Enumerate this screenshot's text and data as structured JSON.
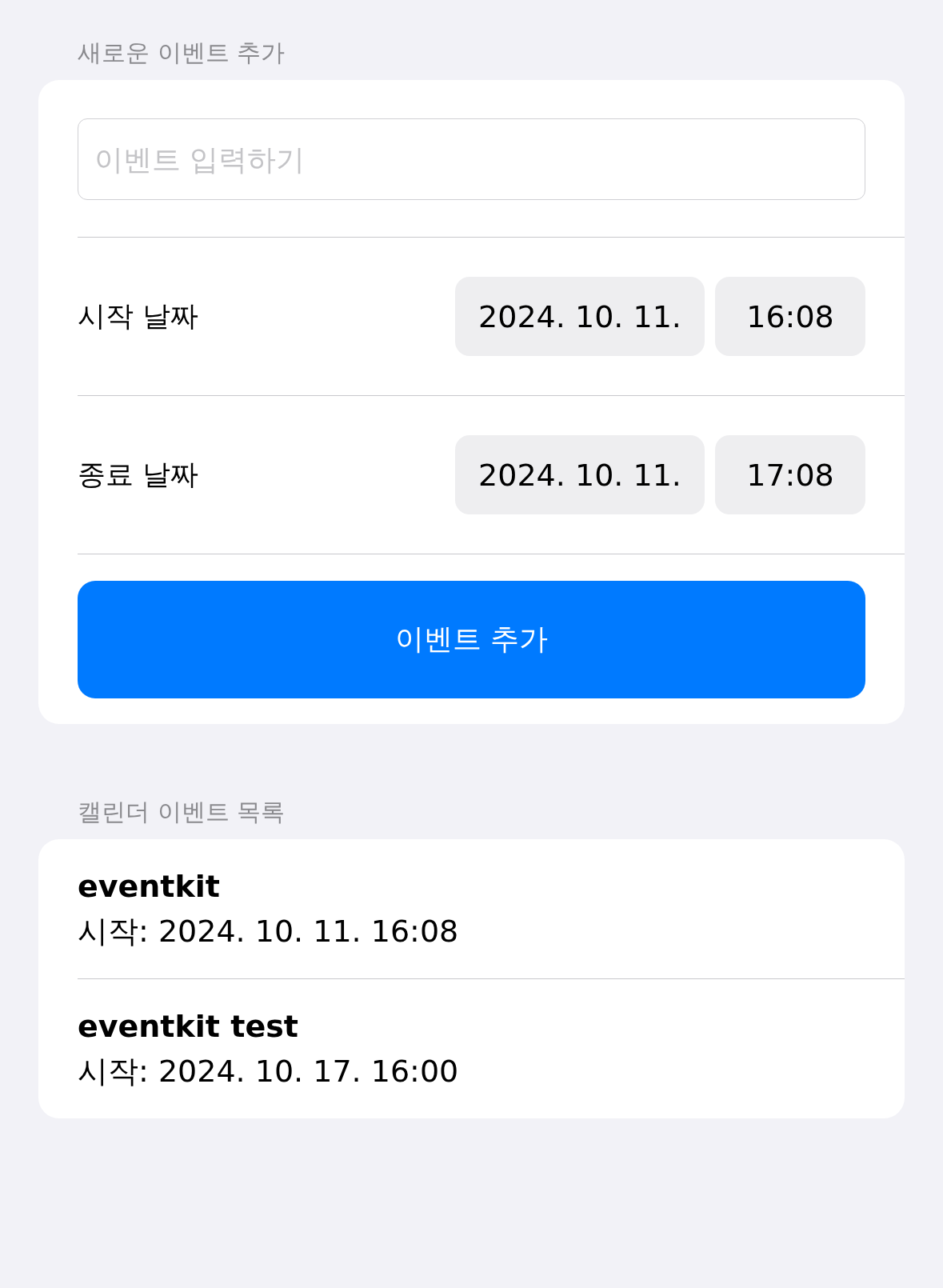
{
  "new_event": {
    "header": "새로운 이벤트 추가",
    "input": {
      "placeholder": "이벤트 입력하기"
    },
    "rows": [
      {
        "label": "시작 날짜",
        "date": "2024. 10. 11.",
        "time": "16:08"
      },
      {
        "label": "종료 날짜",
        "date": "2024. 10. 11.",
        "time": "17:08"
      }
    ],
    "button": "이벤트 추가"
  },
  "event_list": {
    "header": "캘린더 이벤트 목록",
    "events": [
      {
        "title": "eventkit",
        "start": "시작: 2024. 10. 11. 16:08"
      },
      {
        "title": "eventkit test",
        "start": "시작: 2024. 10. 17. 16:00"
      }
    ]
  }
}
